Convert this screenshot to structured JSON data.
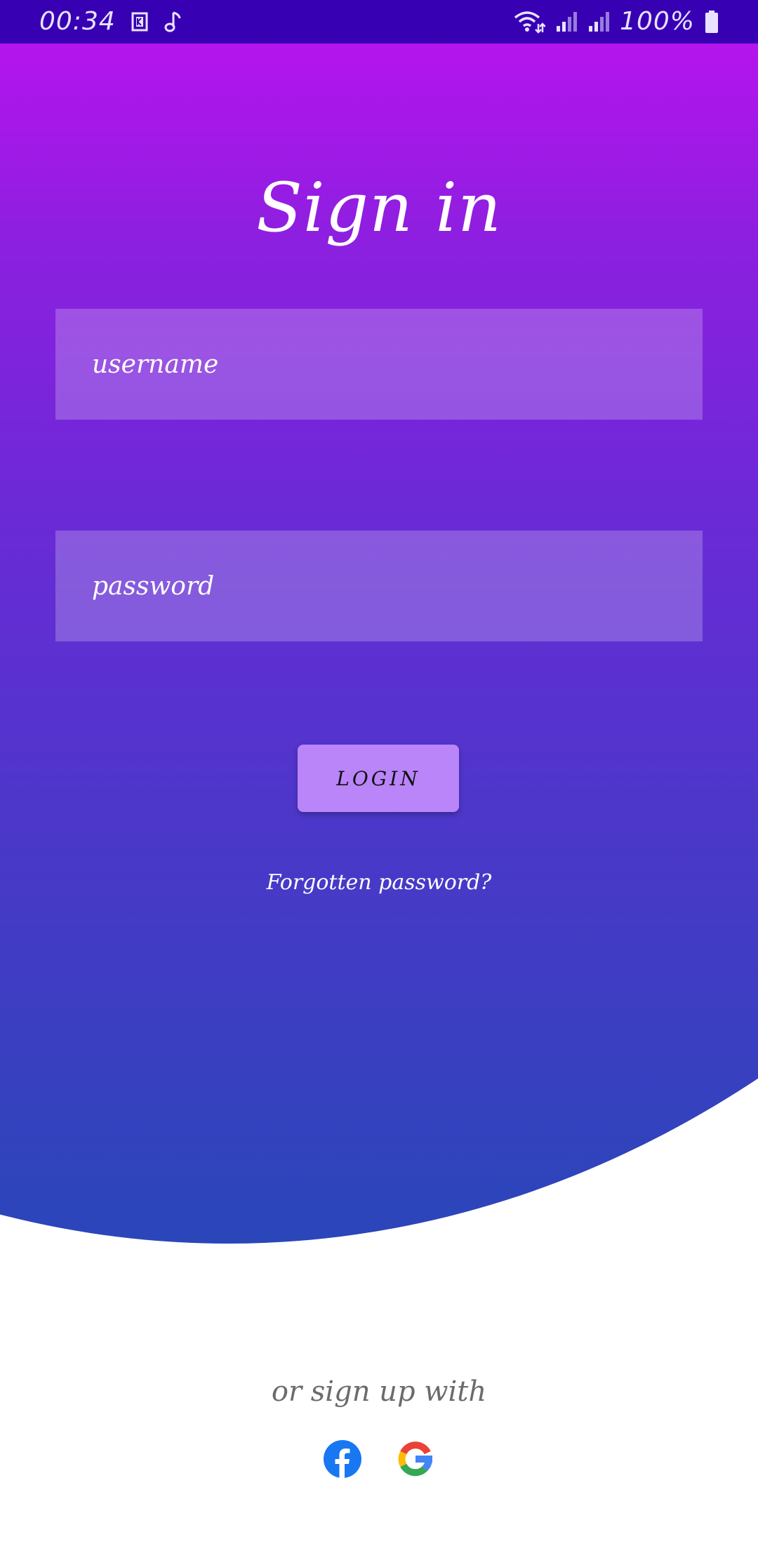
{
  "status_bar": {
    "time": "00:34",
    "battery": "100%",
    "icons": [
      "notification-k-icon",
      "music-note-icon",
      "wifi-icon",
      "signal-icon",
      "signal-icon-2",
      "battery-icon"
    ]
  },
  "title": "Sign in",
  "form": {
    "username_placeholder": "username",
    "password_placeholder": "password",
    "login_label": "LOGIN",
    "forgot_label": "Forgotten password?"
  },
  "signup": {
    "label": "or sign up with",
    "providers": [
      "facebook-icon",
      "google-icon"
    ]
  },
  "colors": {
    "status_bar": "#3700b3",
    "gradient_top": "#b713ee",
    "gradient_bottom": "#2a46b9",
    "button": "#b985f9",
    "facebook": "#1877f2"
  }
}
